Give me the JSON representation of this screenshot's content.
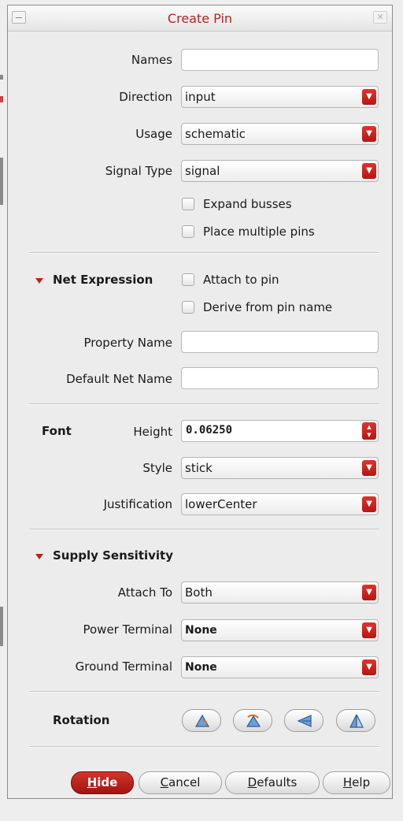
{
  "window": {
    "title": "Create Pin",
    "close_glyph": "✕"
  },
  "fields": {
    "names": {
      "label": "Names",
      "value": ""
    },
    "direction": {
      "label": "Direction",
      "value": "input"
    },
    "usage": {
      "label": "Usage",
      "value": "schematic"
    },
    "signal_type": {
      "label": "Signal Type",
      "value": "signal"
    },
    "expand_busses": {
      "label": "Expand busses",
      "checked": false
    },
    "place_multiple_pins": {
      "label": "Place multiple pins",
      "checked": false
    }
  },
  "net_expression": {
    "title": "Net Expression",
    "attach_to_pin": {
      "label": "Attach to pin",
      "checked": false
    },
    "derive_from_pin_name": {
      "label": "Derive from pin name",
      "checked": false
    },
    "property_name": {
      "label": "Property Name",
      "value": ""
    },
    "default_net_name": {
      "label": "Default Net Name",
      "value": ""
    }
  },
  "font": {
    "title": "Font",
    "height": {
      "label": "Height",
      "value": "0.06250"
    },
    "style": {
      "label": "Style",
      "value": "stick"
    },
    "justification": {
      "label": "Justification",
      "value": "lowerCenter"
    }
  },
  "supply_sensitivity": {
    "title": "Supply Sensitivity",
    "attach_to": {
      "label": "Attach To",
      "value": "Both"
    },
    "power_terminal": {
      "label": "Power Terminal",
      "value": "None"
    },
    "ground_terminal": {
      "label": "Ground Terminal",
      "value": "None"
    }
  },
  "rotation": {
    "title": "Rotation",
    "buttons": [
      "rotate-icon",
      "sideways-icon",
      "upside-down-icon",
      "flip-icon"
    ]
  },
  "buttons": {
    "hide": {
      "mnemonic": "H",
      "rest": "ide"
    },
    "cancel": {
      "mnemonic": "C",
      "rest": "ancel"
    },
    "defaults": {
      "mnemonic": "D",
      "rest": "efaults"
    },
    "help": {
      "mnemonic": "H",
      "rest": "elp"
    }
  },
  "colors": {
    "accent": "#c51e18",
    "title": "#b8231f",
    "background": "#edecec"
  }
}
